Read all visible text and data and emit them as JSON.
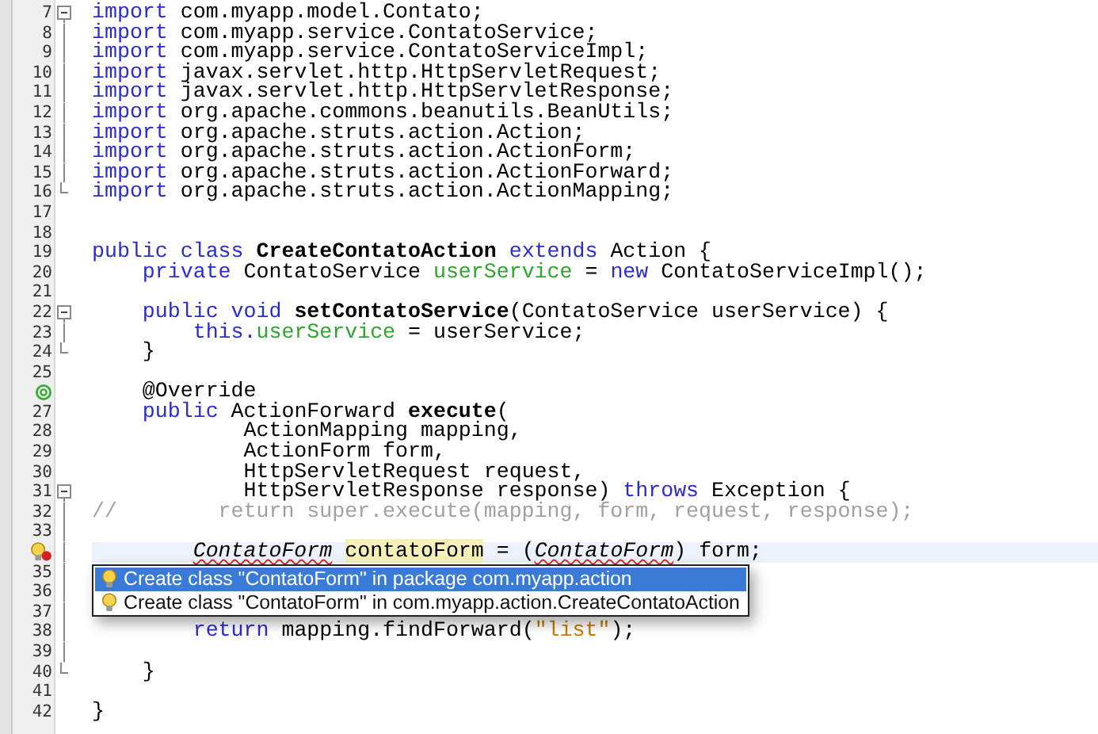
{
  "editor": {
    "lines": [
      {
        "number": "7",
        "kind": "fold-start",
        "current": false,
        "segments": [
          {
            "text": "import",
            "kind": "keyword"
          },
          {
            "text": " com.myapp.model.Contato;",
            "kind": "plain"
          }
        ]
      },
      {
        "number": "8",
        "kind": "fold-mid",
        "current": false,
        "segments": [
          {
            "text": "import",
            "kind": "keyword"
          },
          {
            "text": " com.myapp.service.ContatoService;",
            "kind": "plain"
          }
        ]
      },
      {
        "number": "9",
        "kind": "fold-mid",
        "current": false,
        "segments": [
          {
            "text": "import",
            "kind": "keyword"
          },
          {
            "text": " com.myapp.service.ContatoServiceImpl;",
            "kind": "plain"
          }
        ]
      },
      {
        "number": "10",
        "kind": "fold-mid",
        "current": false,
        "segments": [
          {
            "text": "import",
            "kind": "keyword"
          },
          {
            "text": " javax.servlet.http.HttpServletRequest;",
            "kind": "plain"
          }
        ]
      },
      {
        "number": "11",
        "kind": "fold-mid",
        "current": false,
        "segments": [
          {
            "text": "import",
            "kind": "keyword"
          },
          {
            "text": " javax.servlet.http.HttpServletResponse;",
            "kind": "plain"
          }
        ]
      },
      {
        "number": "12",
        "kind": "fold-mid",
        "current": false,
        "segments": [
          {
            "text": "import",
            "kind": "keyword"
          },
          {
            "text": " org.apache.commons.beanutils.BeanUtils;",
            "kind": "plain"
          }
        ]
      },
      {
        "number": "13",
        "kind": "fold-mid",
        "current": false,
        "segments": [
          {
            "text": "import",
            "kind": "keyword"
          },
          {
            "text": " org.apache.struts.action.Action;",
            "kind": "plain"
          }
        ]
      },
      {
        "number": "14",
        "kind": "fold-mid",
        "current": false,
        "segments": [
          {
            "text": "import",
            "kind": "keyword"
          },
          {
            "text": " org.apache.struts.action.ActionForm;",
            "kind": "plain"
          }
        ]
      },
      {
        "number": "15",
        "kind": "fold-mid",
        "current": false,
        "segments": [
          {
            "text": "import",
            "kind": "keyword"
          },
          {
            "text": " org.apache.struts.action.ActionForward;",
            "kind": "plain"
          }
        ]
      },
      {
        "number": "16",
        "kind": "fold-end",
        "current": false,
        "segments": [
          {
            "text": "import",
            "kind": "keyword"
          },
          {
            "text": " org.apache.struts.action.ActionMapping;",
            "kind": "plain"
          }
        ]
      },
      {
        "number": "17",
        "kind": "plain",
        "current": false
      },
      {
        "number": "18",
        "kind": "plain",
        "current": false
      },
      {
        "number": "19",
        "kind": "plain",
        "current": false,
        "segments": [
          {
            "text": "public class ",
            "kind": "keyword"
          },
          {
            "text": "CreateContatoAction",
            "kind": "bold"
          },
          {
            "text": " extends",
            "kind": "keyword"
          },
          {
            "text": " Action {",
            "kind": "plain"
          }
        ]
      },
      {
        "number": "20",
        "kind": "plain",
        "current": false,
        "segments": [
          {
            "text": "    private",
            "kind": "keyword"
          },
          {
            "text": " ContatoService ",
            "kind": "plain"
          },
          {
            "text": "userService",
            "kind": "field"
          },
          {
            "text": " = ",
            "kind": "plain"
          },
          {
            "text": "new",
            "kind": "keyword"
          },
          {
            "text": " ContatoServiceImpl();",
            "kind": "plain"
          }
        ]
      },
      {
        "number": "21",
        "kind": "plain",
        "current": false
      },
      {
        "number": "22",
        "kind": "fold-start",
        "current": false,
        "segments": [
          {
            "text": "    public void ",
            "kind": "keyword"
          },
          {
            "text": "setContatoService",
            "kind": "bold"
          },
          {
            "text": "(ContatoService userService) {",
            "kind": "plain"
          }
        ]
      },
      {
        "number": "23",
        "kind": "fold-mid",
        "current": false,
        "segments": [
          {
            "text": "        this.",
            "kind": "keyword"
          },
          {
            "text": "userService",
            "kind": "field"
          },
          {
            "text": " = userService;",
            "kind": "plain"
          }
        ]
      },
      {
        "number": "24",
        "kind": "fold-end",
        "current": false,
        "segments": [
          {
            "text": "    }",
            "kind": "plain"
          }
        ]
      },
      {
        "number": "25",
        "kind": "plain",
        "current": false
      },
      {
        "marker": {
          "kind": "override"
        },
        "kind": "plain",
        "current": false,
        "segments": [
          {
            "text": "    @Override",
            "kind": "plain"
          }
        ]
      },
      {
        "number": "27",
        "kind": "plain",
        "current": false,
        "segments": [
          {
            "text": "    public",
            "kind": "keyword"
          },
          {
            "text": " ActionForward ",
            "kind": "plain"
          },
          {
            "text": "execute",
            "kind": "bold"
          },
          {
            "text": "(",
            "kind": "plain"
          }
        ]
      },
      {
        "number": "28",
        "kind": "plain",
        "current": false,
        "segments": [
          {
            "text": "            ActionMapping mapping,",
            "kind": "plain"
          }
        ]
      },
      {
        "number": "29",
        "kind": "plain",
        "current": false,
        "segments": [
          {
            "text": "            ActionForm form,",
            "kind": "plain"
          }
        ]
      },
      {
        "number": "30",
        "kind": "plain",
        "current": false,
        "segments": [
          {
            "text": "            HttpServletRequest request,",
            "kind": "plain"
          }
        ]
      },
      {
        "number": "31",
        "kind": "fold-start",
        "current": false,
        "segments": [
          {
            "text": "            HttpServletResponse response) ",
            "kind": "plain"
          },
          {
            "text": "throws",
            "kind": "keyword"
          },
          {
            "text": " Exception {",
            "kind": "plain"
          }
        ]
      },
      {
        "number": "32",
        "kind": "fold-mid",
        "current": false,
        "segments": [
          {
            "text": "//        return super.execute(mapping, form, request, response);",
            "kind": "comment"
          }
        ]
      },
      {
        "number": "33",
        "kind": "fold-mid",
        "current": false
      },
      {
        "marker": {
          "kind": "hint-error"
        },
        "kind": "fold-mid",
        "current": true,
        "segments": [
          {
            "text": "        ContatoForm ",
            "kind": "error"
          },
          {
            "text": "contatoForm",
            "kind": "mark"
          },
          {
            "text": " = (",
            "kind": "plain"
          },
          {
            "text": "ContatoForm",
            "kind": "error"
          },
          {
            "text": ") form;",
            "kind": "plain"
          }
        ]
      },
      {
        "number": "35",
        "kind": "fold-mid",
        "current": false
      },
      {
        "number": "36",
        "kind": "fold-mid",
        "current": false
      },
      {
        "number": "37",
        "kind": "fold-mid",
        "current": false
      },
      {
        "number": "38",
        "kind": "fold-mid",
        "current": false,
        "segments": [
          {
            "text": "        return",
            "kind": "keyword"
          },
          {
            "text": " mapping.findForward(",
            "kind": "plain"
          },
          {
            "text": "\"list\"",
            "kind": "string"
          },
          {
            "text": ");",
            "kind": "plain"
          }
        ]
      },
      {
        "number": "39",
        "kind": "fold-mid",
        "current": false
      },
      {
        "number": "40",
        "kind": "fold-end",
        "current": false,
        "segments": [
          {
            "text": "    }",
            "kind": "plain"
          }
        ]
      },
      {
        "number": "41",
        "kind": "plain",
        "current": false
      },
      {
        "number": "42",
        "kind": "plain",
        "current": false,
        "segments": [
          {
            "text": "}",
            "kind": "plain"
          }
        ]
      }
    ]
  },
  "popup": {
    "items": [
      {
        "label": "Create class \"ContatoForm\" in package com.myapp.action",
        "selected": true
      },
      {
        "label": "Create class \"ContatoForm\" in com.myapp.action.CreateContatoAction",
        "selected": false
      }
    ]
  }
}
